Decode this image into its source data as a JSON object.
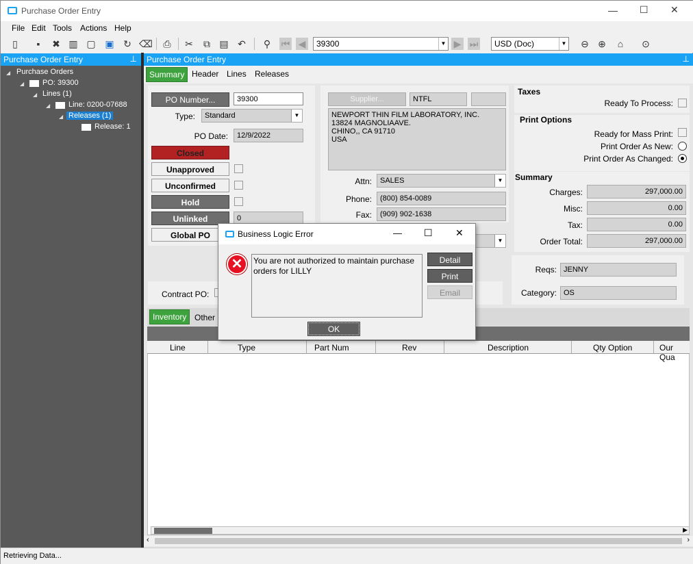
{
  "window": {
    "title": "Purchase Order Entry",
    "controls": {
      "minimize": "—",
      "maximize": "☐",
      "close": "✕"
    }
  },
  "menu": [
    "File",
    "Edit",
    "Tools",
    "Actions",
    "Help"
  ],
  "toolbar": {
    "po_combo_value": "39300",
    "currency_combo_value": "USD (Doc)"
  },
  "tree_panel": {
    "title": "Purchase Order Entry",
    "nodes": {
      "root": "Purchase Orders",
      "po": "PO: 39300",
      "lines": "Lines (1)",
      "line": "Line: 0200-07688",
      "releases": "Releases (1)",
      "release": "Release: 1"
    }
  },
  "main_panel": {
    "title": "Purchase Order Entry",
    "tabs": [
      "Summary",
      "Header",
      "Lines",
      "Releases"
    ],
    "po_number_button": "PO Number...",
    "po_number": "39300",
    "type_label": "Type:",
    "type_value": "Standard",
    "po_date_label": "PO Date:",
    "po_date": "12/9/2022",
    "closed": "Closed",
    "unapproved": "Unapproved",
    "unconfirmed": "Unconfirmed",
    "hold": "Hold",
    "unlinked": "Unlinked",
    "unlinked_value": "0",
    "global_po": "Global PO",
    "supplier_button": "Supplier...",
    "supplier_id": "NTFL",
    "supplier_address": [
      "NEWPORT THIN FILM LABORATORY, INC.",
      "13824 MAGNOLIAAVE.",
      "CHINO,, CA  91710",
      "USA"
    ],
    "attn_label": "Attn:",
    "attn_value": "SALES",
    "phone_label": "Phone:",
    "phone_value": "(800) 854-0089",
    "fax_label": "Fax:",
    "fax_value": "(909) 902-1638",
    "contract_po_label": "Contract PO:",
    "taxes_title": "Taxes",
    "ready_to_process": "Ready To Process:",
    "print_options_title": "Print Options",
    "ready_mass_print": "Ready for Mass Print:",
    "print_as_new": "Print Order As New:",
    "print_as_changed": "Print Order As Changed:",
    "summary_title": "Summary",
    "charges_label": "Charges:",
    "charges_value": "297,000.00",
    "misc_label": "Misc:",
    "misc_value": "0.00",
    "tax_label": "Tax:",
    "tax_value": "0.00",
    "order_total_label": "Order Total:",
    "order_total_value": "297,000.00",
    "reqs_label": "Reqs:",
    "reqs_value": "JENNY",
    "category_label": "Category:",
    "category_value": "OS",
    "lower_tabs": [
      "Inventory",
      "Other"
    ],
    "grid_columns": [
      "Line",
      "Type",
      "Part Num",
      "Rev",
      "Description",
      "Qty Option",
      "Our Qua"
    ]
  },
  "dialog": {
    "title": "Business Logic Error",
    "message": "You are not authorized to maintain purchase orders for LILLY",
    "detail_button": "Detail",
    "print_button": "Print",
    "email_button": "Email",
    "ok_button": "OK",
    "controls": {
      "minimize": "—",
      "maximize": "☐",
      "close": "✕"
    }
  },
  "status": {
    "text": "Retrieving Data..."
  },
  "colors": {
    "accent": "#1aa3f5",
    "tab_active": "#3ea33e",
    "closed_flag": "#b22222",
    "tree_bg": "#595959",
    "error": "#e81123"
  }
}
